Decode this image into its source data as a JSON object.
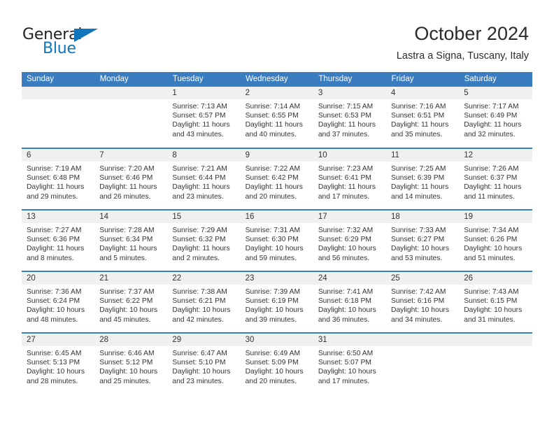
{
  "brand": {
    "name_part1": "General",
    "name_part2": "Blue",
    "accent_color": "#1175bb"
  },
  "header": {
    "title": "October 2024",
    "subtitle": "Lastra a Signa, Tuscany, Italy",
    "header_bg_color": "#3a7cc0"
  },
  "calendar": {
    "weekday_headers": [
      "Sunday",
      "Monday",
      "Tuesday",
      "Wednesday",
      "Thursday",
      "Friday",
      "Saturday"
    ],
    "weeks": [
      [
        {
          "day": "",
          "sunrise": "",
          "sunset": "",
          "daylight": ""
        },
        {
          "day": "",
          "sunrise": "",
          "sunset": "",
          "daylight": ""
        },
        {
          "day": "1",
          "sunrise": "Sunrise: 7:13 AM",
          "sunset": "Sunset: 6:57 PM",
          "daylight": "Daylight: 11 hours and 43 minutes."
        },
        {
          "day": "2",
          "sunrise": "Sunrise: 7:14 AM",
          "sunset": "Sunset: 6:55 PM",
          "daylight": "Daylight: 11 hours and 40 minutes."
        },
        {
          "day": "3",
          "sunrise": "Sunrise: 7:15 AM",
          "sunset": "Sunset: 6:53 PM",
          "daylight": "Daylight: 11 hours and 37 minutes."
        },
        {
          "day": "4",
          "sunrise": "Sunrise: 7:16 AM",
          "sunset": "Sunset: 6:51 PM",
          "daylight": "Daylight: 11 hours and 35 minutes."
        },
        {
          "day": "5",
          "sunrise": "Sunrise: 7:17 AM",
          "sunset": "Sunset: 6:49 PM",
          "daylight": "Daylight: 11 hours and 32 minutes."
        }
      ],
      [
        {
          "day": "6",
          "sunrise": "Sunrise: 7:19 AM",
          "sunset": "Sunset: 6:48 PM",
          "daylight": "Daylight: 11 hours and 29 minutes."
        },
        {
          "day": "7",
          "sunrise": "Sunrise: 7:20 AM",
          "sunset": "Sunset: 6:46 PM",
          "daylight": "Daylight: 11 hours and 26 minutes."
        },
        {
          "day": "8",
          "sunrise": "Sunrise: 7:21 AM",
          "sunset": "Sunset: 6:44 PM",
          "daylight": "Daylight: 11 hours and 23 minutes."
        },
        {
          "day": "9",
          "sunrise": "Sunrise: 7:22 AM",
          "sunset": "Sunset: 6:42 PM",
          "daylight": "Daylight: 11 hours and 20 minutes."
        },
        {
          "day": "10",
          "sunrise": "Sunrise: 7:23 AM",
          "sunset": "Sunset: 6:41 PM",
          "daylight": "Daylight: 11 hours and 17 minutes."
        },
        {
          "day": "11",
          "sunrise": "Sunrise: 7:25 AM",
          "sunset": "Sunset: 6:39 PM",
          "daylight": "Daylight: 11 hours and 14 minutes."
        },
        {
          "day": "12",
          "sunrise": "Sunrise: 7:26 AM",
          "sunset": "Sunset: 6:37 PM",
          "daylight": "Daylight: 11 hours and 11 minutes."
        }
      ],
      [
        {
          "day": "13",
          "sunrise": "Sunrise: 7:27 AM",
          "sunset": "Sunset: 6:36 PM",
          "daylight": "Daylight: 11 hours and 8 minutes."
        },
        {
          "day": "14",
          "sunrise": "Sunrise: 7:28 AM",
          "sunset": "Sunset: 6:34 PM",
          "daylight": "Daylight: 11 hours and 5 minutes."
        },
        {
          "day": "15",
          "sunrise": "Sunrise: 7:29 AM",
          "sunset": "Sunset: 6:32 PM",
          "daylight": "Daylight: 11 hours and 2 minutes."
        },
        {
          "day": "16",
          "sunrise": "Sunrise: 7:31 AM",
          "sunset": "Sunset: 6:30 PM",
          "daylight": "Daylight: 10 hours and 59 minutes."
        },
        {
          "day": "17",
          "sunrise": "Sunrise: 7:32 AM",
          "sunset": "Sunset: 6:29 PM",
          "daylight": "Daylight: 10 hours and 56 minutes."
        },
        {
          "day": "18",
          "sunrise": "Sunrise: 7:33 AM",
          "sunset": "Sunset: 6:27 PM",
          "daylight": "Daylight: 10 hours and 53 minutes."
        },
        {
          "day": "19",
          "sunrise": "Sunrise: 7:34 AM",
          "sunset": "Sunset: 6:26 PM",
          "daylight": "Daylight: 10 hours and 51 minutes."
        }
      ],
      [
        {
          "day": "20",
          "sunrise": "Sunrise: 7:36 AM",
          "sunset": "Sunset: 6:24 PM",
          "daylight": "Daylight: 10 hours and 48 minutes."
        },
        {
          "day": "21",
          "sunrise": "Sunrise: 7:37 AM",
          "sunset": "Sunset: 6:22 PM",
          "daylight": "Daylight: 10 hours and 45 minutes."
        },
        {
          "day": "22",
          "sunrise": "Sunrise: 7:38 AM",
          "sunset": "Sunset: 6:21 PM",
          "daylight": "Daylight: 10 hours and 42 minutes."
        },
        {
          "day": "23",
          "sunrise": "Sunrise: 7:39 AM",
          "sunset": "Sunset: 6:19 PM",
          "daylight": "Daylight: 10 hours and 39 minutes."
        },
        {
          "day": "24",
          "sunrise": "Sunrise: 7:41 AM",
          "sunset": "Sunset: 6:18 PM",
          "daylight": "Daylight: 10 hours and 36 minutes."
        },
        {
          "day": "25",
          "sunrise": "Sunrise: 7:42 AM",
          "sunset": "Sunset: 6:16 PM",
          "daylight": "Daylight: 10 hours and 34 minutes."
        },
        {
          "day": "26",
          "sunrise": "Sunrise: 7:43 AM",
          "sunset": "Sunset: 6:15 PM",
          "daylight": "Daylight: 10 hours and 31 minutes."
        }
      ],
      [
        {
          "day": "27",
          "sunrise": "Sunrise: 6:45 AM",
          "sunset": "Sunset: 5:13 PM",
          "daylight": "Daylight: 10 hours and 28 minutes."
        },
        {
          "day": "28",
          "sunrise": "Sunrise: 6:46 AM",
          "sunset": "Sunset: 5:12 PM",
          "daylight": "Daylight: 10 hours and 25 minutes."
        },
        {
          "day": "29",
          "sunrise": "Sunrise: 6:47 AM",
          "sunset": "Sunset: 5:10 PM",
          "daylight": "Daylight: 10 hours and 23 minutes."
        },
        {
          "day": "30",
          "sunrise": "Sunrise: 6:49 AM",
          "sunset": "Sunset: 5:09 PM",
          "daylight": "Daylight: 10 hours and 20 minutes."
        },
        {
          "day": "31",
          "sunrise": "Sunrise: 6:50 AM",
          "sunset": "Sunset: 5:07 PM",
          "daylight": "Daylight: 10 hours and 17 minutes."
        },
        {
          "day": "",
          "sunrise": "",
          "sunset": "",
          "daylight": ""
        },
        {
          "day": "",
          "sunrise": "",
          "sunset": "",
          "daylight": ""
        }
      ]
    ]
  }
}
